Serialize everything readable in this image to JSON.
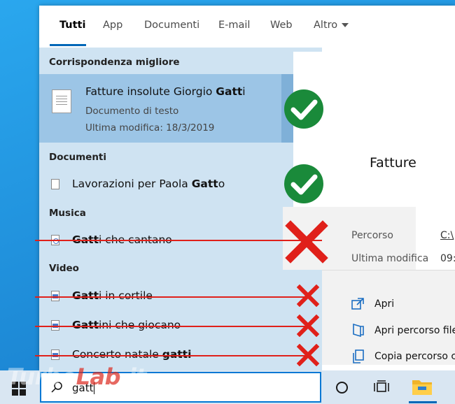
{
  "tabs": [
    {
      "label": "Tutti",
      "active": true
    },
    {
      "label": "App"
    },
    {
      "label": "Documenti"
    },
    {
      "label": "E-mail"
    },
    {
      "label": "Web"
    },
    {
      "label": "Altro"
    }
  ],
  "sections": {
    "best_match": "Corrispondenza migliore",
    "documents": "Documenti",
    "music": "Musica",
    "video": "Video"
  },
  "best_match": {
    "title_prefix": "Fatture insolute Giorgio ",
    "title_highlight": "Gatt",
    "title_suffix": "i",
    "type": "Documento di testo",
    "modified": "Ultima modifica: 18/3/2019"
  },
  "documents": [
    {
      "prefix": "Lavorazioni per Paola ",
      "highlight": "Gatt",
      "suffix": "o"
    }
  ],
  "music": [
    {
      "prefix": "",
      "highlight": "Gatt",
      "suffix": "i che cantano"
    }
  ],
  "video": [
    {
      "prefix": "",
      "highlight": "Gatt",
      "suffix": "i in cortile"
    },
    {
      "prefix": "",
      "highlight": "Gatt",
      "suffix": "ini che giocano"
    },
    {
      "prefix": "Concerto natale ",
      "highlight": "gatti",
      "suffix": ""
    }
  ],
  "preview": {
    "title": "Fatture",
    "path_label": "Percorso",
    "path_value": "C:\\",
    "modified_label": "Ultima modifica",
    "modified_value": "09:",
    "actions": [
      "Apri",
      "Apri percorso file",
      "Copia percorso c"
    ]
  },
  "search": {
    "query": "gatt"
  },
  "watermark": {
    "part1": "Turbo",
    "part2": "Lab",
    "part3": ".it"
  },
  "colors": {
    "accent": "#0078d4",
    "check_green": "#1a8a3a",
    "cross_red": "#e0201a",
    "results_bg": "#cfe3f2",
    "selected_bg": "#9cc5e6"
  }
}
